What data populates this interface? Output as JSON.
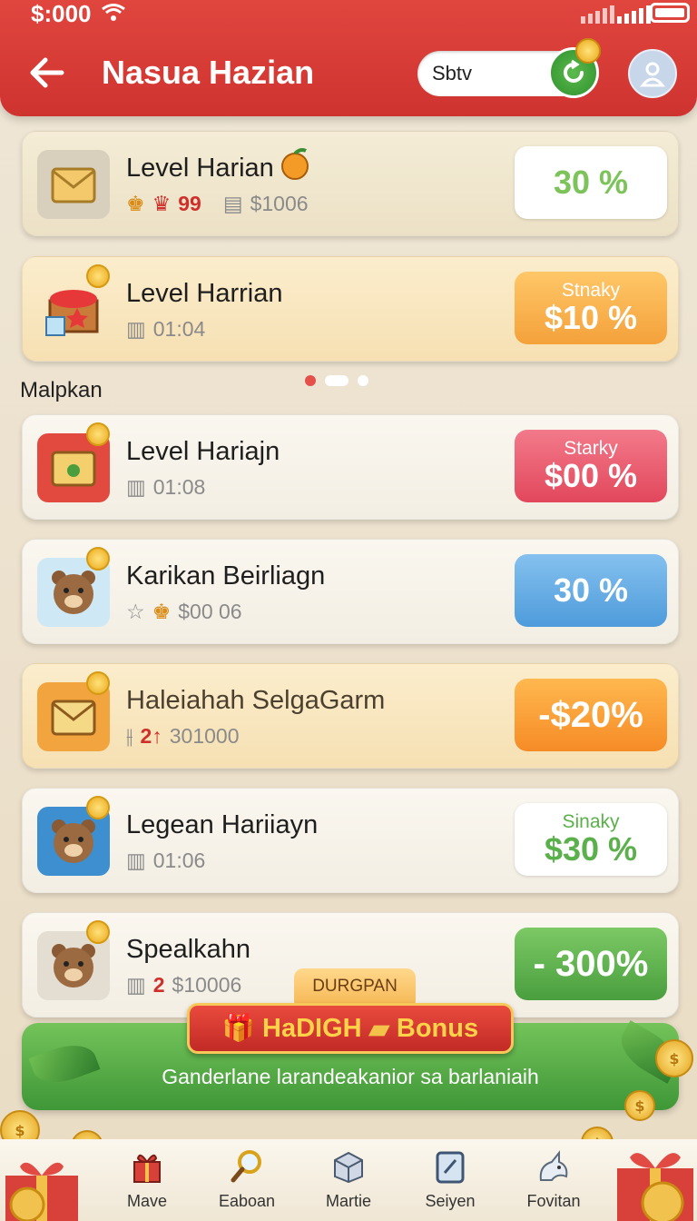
{
  "status": {
    "time": "$:000"
  },
  "header": {
    "title": "Nasua Hazian",
    "search_value": "Sbtv"
  },
  "section_label": "Malpkan",
  "cards": [
    {
      "title": "Level Harian",
      "meta_primary": "99",
      "meta_secondary": "$1006",
      "badge_small": "",
      "badge_main": "30 %"
    },
    {
      "title": "Level Harrian",
      "meta_primary": "",
      "meta_secondary": "01:04",
      "badge_small": "Stnaky",
      "badge_main": "$10 %"
    },
    {
      "title": "Level Hariajn",
      "meta_primary": "",
      "meta_secondary": "01:08",
      "badge_small": "Starky",
      "badge_main": "$00 %"
    },
    {
      "title": "Karikan Beirliagn",
      "meta_primary": "",
      "meta_secondary": "$00 06",
      "badge_small": "",
      "badge_main": "30 %"
    },
    {
      "title": "Haleiahah SelgaGarm",
      "meta_primary": "2↑",
      "meta_secondary": "301000",
      "badge_small": "",
      "badge_main": "-$20%"
    },
    {
      "title": "Legean Hariiayn",
      "meta_primary": "",
      "meta_secondary": "01:06",
      "badge_small": "Sinaky",
      "badge_main": "$30 %"
    },
    {
      "title": "Spealkahn",
      "meta_primary": "2",
      "meta_secondary": "$10006",
      "badge_small": "",
      "badge_main": "- 300%"
    }
  ],
  "bonus": {
    "tab_label": "DURGPAN",
    "title": "HaDIGH",
    "bonus_word": "Bonus",
    "subtitle": "Ganderlane larandeakanior sa barlaniaih"
  },
  "nav": [
    {
      "label": "Mave",
      "icon": "gift-icon"
    },
    {
      "label": "Eaboan",
      "icon": "magnifier-icon"
    },
    {
      "label": "Martie",
      "icon": "box-icon"
    },
    {
      "label": "Seiyen",
      "icon": "tablet-icon"
    },
    {
      "label": "Fovitan",
      "icon": "unicorn-icon"
    }
  ],
  "colors": {
    "header_red": "#d93a35",
    "accent_green": "#4a9e3e",
    "accent_orange": "#f4a13a",
    "badge_red": "#e2475c",
    "badge_blue": "#4e9bdb"
  }
}
